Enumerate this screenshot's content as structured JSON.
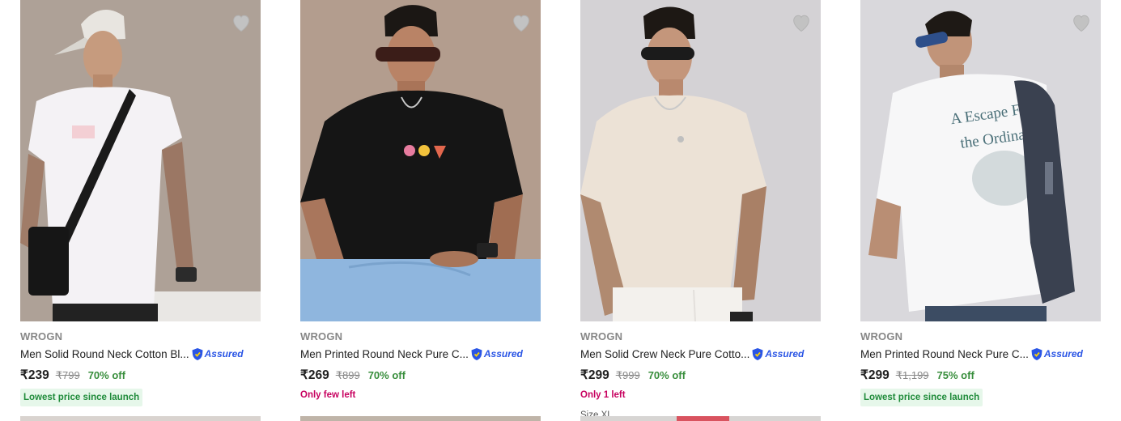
{
  "products": [
    {
      "brand": "WROGN",
      "title": "Men Solid Round Neck Cotton Bl...",
      "assured": "Assured",
      "price": "₹239",
      "mrp": "₹799",
      "discount": "70% off",
      "badge": "Lowest price since launch",
      "stock": ""
    },
    {
      "brand": "WROGN",
      "title": "Men Printed Round Neck Pure C...",
      "assured": "Assured",
      "price": "₹269",
      "mrp": "₹899",
      "discount": "70% off",
      "badge": "",
      "stock": "Only few left"
    },
    {
      "brand": "WROGN",
      "title": "Men Solid Crew Neck Pure Cotto...",
      "assured": "Assured",
      "price": "₹299",
      "mrp": "₹999",
      "discount": "70% off",
      "badge": "",
      "stock": "Only 1 left"
    },
    {
      "brand": "WROGN",
      "title": "Men Printed Round Neck Pure C...",
      "assured": "Assured",
      "price": "₹299",
      "mrp": "₹1,199",
      "discount": "75% off",
      "badge": "Lowest price since launch",
      "stock": ""
    }
  ],
  "next_row": {
    "size_hint": "Size XL"
  },
  "print_text": {
    "line1": "A Escape From",
    "line2": "the Ordinary"
  },
  "colors": {
    "price_green": "#388e3c",
    "assured_blue": "#2a55e5",
    "stock_pink": "#c7005f",
    "badge_bg": "#e6f7ea"
  }
}
